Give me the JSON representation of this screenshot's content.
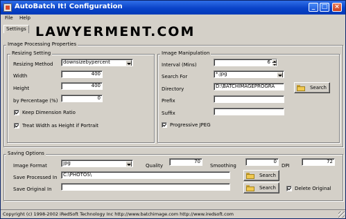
{
  "window": {
    "title": "AutoBatch It! Configuration"
  },
  "menu": [
    "File",
    "Help"
  ],
  "tab": "Settings",
  "watermark": "LAWYERMENT.COM",
  "image_processing": {
    "title": "Image Processing Properties",
    "resizing": {
      "title": "Resizing Setting",
      "method_label": "Resizing Method",
      "method_value": "downsizebypercent",
      "width_label": "Width",
      "width_value": "400",
      "height_label": "Height",
      "height_value": "400",
      "percentage_label": "by Percentage (%)",
      "percentage_value": "0",
      "keep_ratio_label": "Keep Dimension Ratio",
      "keep_ratio_checked": true,
      "portrait_label": "Treat Width as Height if Portrait",
      "portrait_checked": true
    },
    "manipulation": {
      "title": "Image Manipulation",
      "interval_label": "Interval (Mins)",
      "interval_value": "6",
      "search_for_label": "Search For",
      "search_for_value": "*.jpg",
      "directory_label": "Directory",
      "directory_value": "D:\\BATCHIMAGEPROGRA",
      "search_button": "Search",
      "prefix_label": "Prefix",
      "prefix_value": "",
      "suffix_label": "Suffix",
      "suffix_value": "",
      "progressive_label": "Progressive JPEG",
      "progressive_checked": true
    }
  },
  "saving": {
    "title": "Saving Options",
    "format_label": "Image Format",
    "format_value": "jpg",
    "quality_label": "Quality",
    "quality_value": "70",
    "smoothing_label": "Smoothing",
    "smoothing_value": "0",
    "dpi_label": "DPI",
    "dpi_value": "72",
    "processed_label": "Save Processed In",
    "processed_value": "C:\\PHOTOS\\",
    "original_label": "Save Original In",
    "original_value": "",
    "search_button_1": "Search",
    "search_button_2": "Search",
    "delete_original_label": "Delete Original",
    "delete_original_checked": true
  },
  "status": "Copyright (c) 1998-2002 iRedSoft Technology Inc http://www.batchimage.com http://www.iredsoft.com"
}
